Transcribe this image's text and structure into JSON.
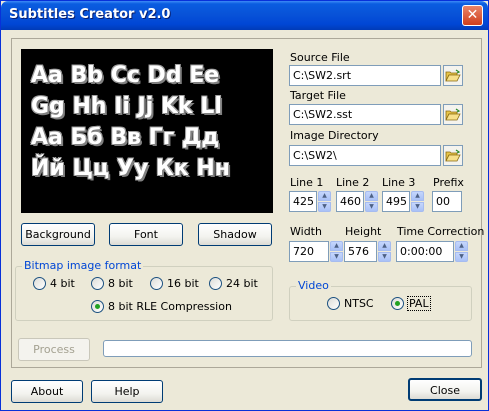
{
  "window": {
    "title": "Subtitles Creator v2.0",
    "close_glyph": "✕"
  },
  "preview": {
    "lines": [
      "Aa Bb Cc Dd Ee",
      "Gg Hh Ii Jj Kk Ll",
      "Аа Бб Вв Гг Дд",
      "Йй Цц Уу Кк Нн"
    ]
  },
  "buttons": {
    "background": "Background",
    "font": "Font",
    "shadow": "Shadow",
    "process": "Process",
    "about": "About",
    "help": "Help",
    "close": "Close"
  },
  "bitmap_format": {
    "legend": "Bitmap image format",
    "options": [
      {
        "label": "4 bit",
        "checked": false
      },
      {
        "label": "8 bit",
        "checked": false
      },
      {
        "label": "16 bit",
        "checked": false
      },
      {
        "label": "24 bit",
        "checked": false
      },
      {
        "label": "8 bit RLE Compression",
        "checked": true
      }
    ]
  },
  "files": {
    "source_label": "Source File",
    "source_value": "C:\\SW2.srt",
    "target_label": "Target File",
    "target_value": "C:\\SW2.sst",
    "imagedir_label": "Image Directory",
    "imagedir_value": "C:\\SW2\\"
  },
  "lines": {
    "line1_label": "Line 1",
    "line1_value": "425",
    "line2_label": "Line 2",
    "line2_value": "460",
    "line3_label": "Line 3",
    "line3_value": "495",
    "prefix_label": "Prefix",
    "prefix_value": "00"
  },
  "dimensions": {
    "width_label": "Width",
    "width_value": "720",
    "height_label": "Height",
    "height_value": "576",
    "time_label": "Time Correction",
    "time_value": "0:00:00"
  },
  "video": {
    "legend": "Video",
    "options": [
      {
        "label": "NTSC",
        "checked": false
      },
      {
        "label": "PAL",
        "checked": true
      }
    ]
  },
  "progress": {
    "value": 0
  },
  "icons": {
    "folder": "folder-open-icon",
    "spin_up": "▲",
    "spin_down": "▼"
  },
  "colors": {
    "title_bar": "#0853d8",
    "legend_text": "#0046d5",
    "radio_dot": "#21a121"
  }
}
